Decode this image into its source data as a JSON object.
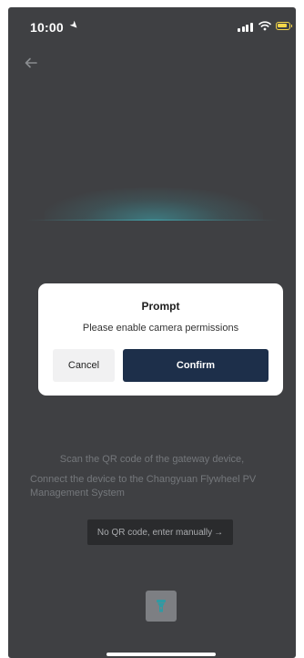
{
  "status_bar": {
    "time": "10:00",
    "location_icon": "location-arrow-icon",
    "signal_icon": "cellular-signal-icon",
    "wifi_icon": "wifi-icon",
    "battery_icon": "battery-charging-icon",
    "battery_color": "#f3d64a"
  },
  "header": {
    "back_icon": "arrow-left-icon"
  },
  "scanner": {
    "line_color": "#46c8d2"
  },
  "instructions": {
    "line1": "Scan the QR code of the gateway device,",
    "line2": "Connect the device to the Changyuan Flywheel PV Management System"
  },
  "manual_entry": {
    "label": "No QR code, enter manually →"
  },
  "flashlight": {
    "icon": "flashlight-icon"
  },
  "dialog": {
    "title": "Prompt",
    "message": "Please enable camera permissions",
    "cancel_label": "Cancel",
    "confirm_label": "Confirm",
    "confirm_color": "#1d2f4a"
  }
}
